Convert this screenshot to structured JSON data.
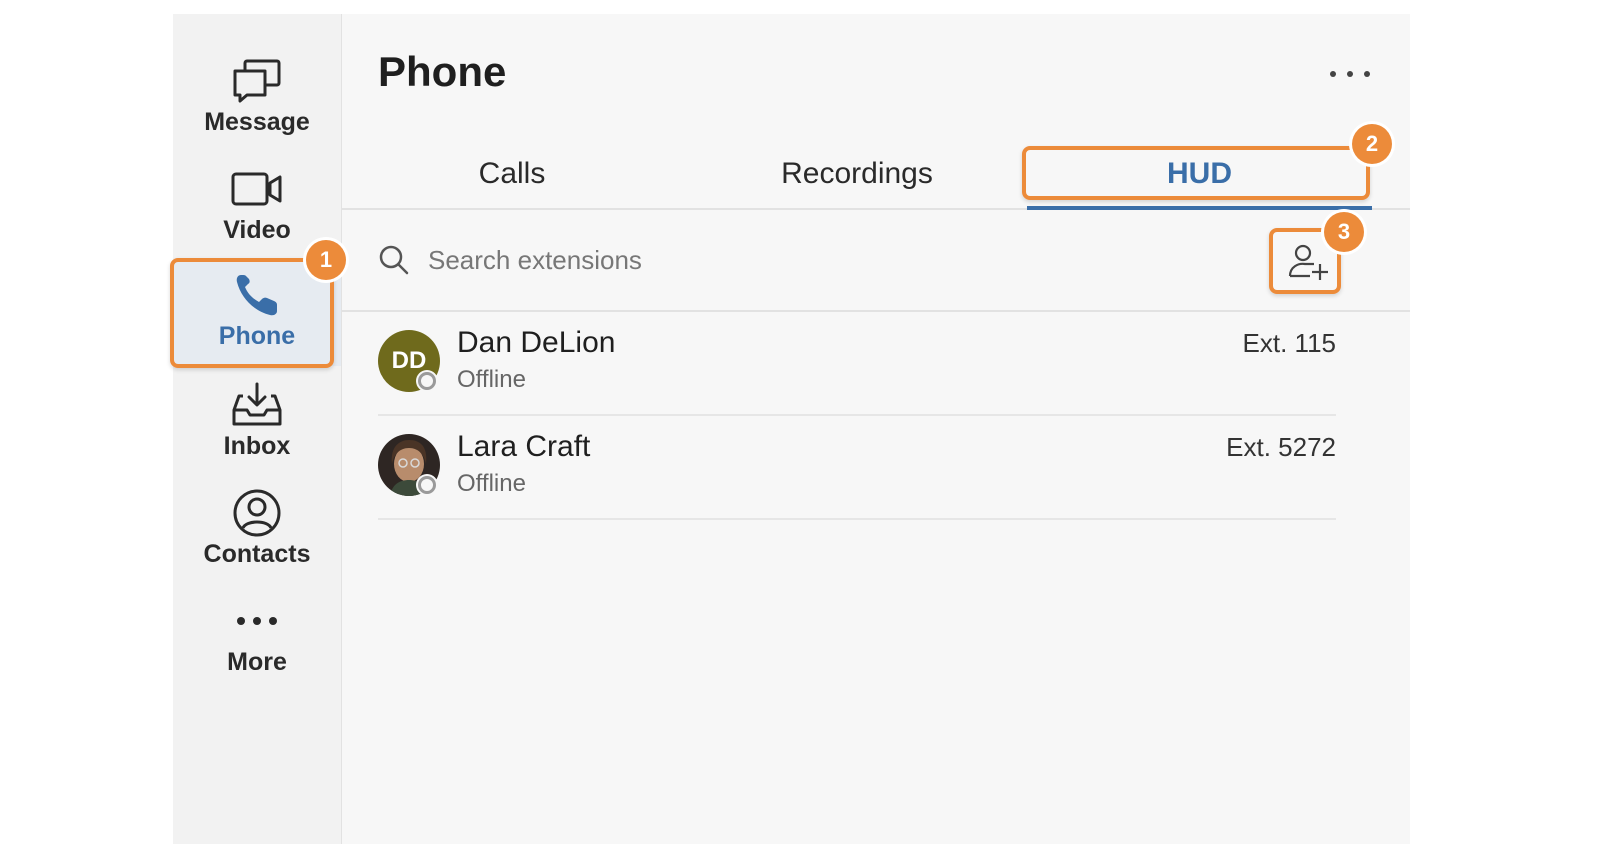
{
  "sidebar": {
    "items": [
      {
        "label": "Message",
        "icon": "message-icon",
        "active": false
      },
      {
        "label": "Video",
        "icon": "video-icon",
        "active": false
      },
      {
        "label": "Phone",
        "icon": "phone-icon",
        "active": true
      },
      {
        "label": "Inbox",
        "icon": "inbox-icon",
        "active": false
      },
      {
        "label": "Contacts",
        "icon": "contacts-icon",
        "active": false
      },
      {
        "label": "More",
        "icon": "more-icon",
        "active": false
      }
    ]
  },
  "header": {
    "title": "Phone",
    "menu_icon": "ellipsis-icon"
  },
  "tabs": [
    {
      "label": "Calls",
      "active": false
    },
    {
      "label": "Recordings",
      "active": false
    },
    {
      "label": "HUD",
      "active": true
    }
  ],
  "search": {
    "placeholder": "Search extensions",
    "value": "",
    "add_icon": "add-person-icon"
  },
  "contacts": [
    {
      "name": "Dan DeLion",
      "initials": "DD",
      "status": "Offline",
      "ext": "Ext. 115",
      "avatar_color": "#6f6a1c"
    },
    {
      "name": "Lara Craft",
      "initials": "",
      "status": "Offline",
      "ext": "Ext. 5272",
      "avatar_color": "#3b2f2a"
    }
  ],
  "callouts": [
    {
      "number": "1"
    },
    {
      "number": "2"
    },
    {
      "number": "3"
    }
  ],
  "colors": {
    "accent": "#3a6ea8",
    "callout": "#ec8b3a"
  }
}
